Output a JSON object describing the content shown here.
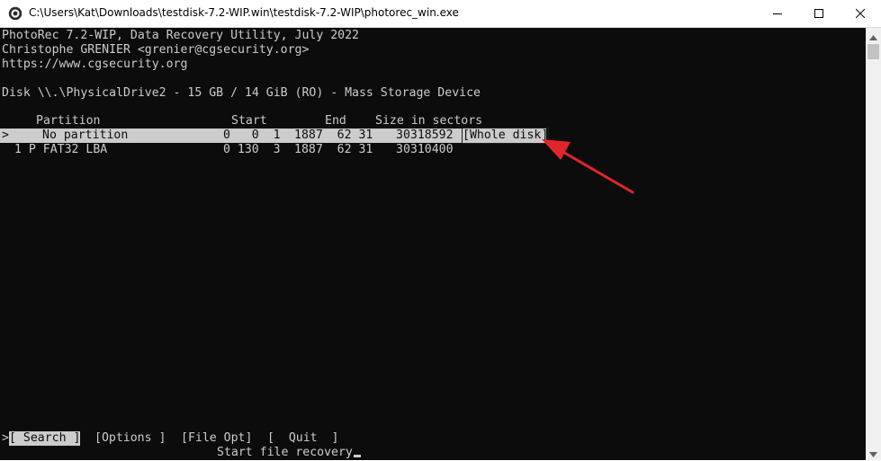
{
  "window": {
    "title": "C:\\Users\\Kat\\Downloads\\testdisk-7.2-WIP.win\\testdisk-7.2-WIP\\photorec_win.exe"
  },
  "header": {
    "line1": "PhotoRec 7.2-WIP, Data Recovery Utility, July 2022",
    "line2": "Christophe GRENIER <grenier@cgsecurity.org>",
    "line3": "https://www.cgsecurity.org"
  },
  "disk": {
    "line": "Disk \\\\.\\PhysicalDrive2 - 15 GB / 14 GiB (RO) - Mass Storage Device"
  },
  "table": {
    "columns": {
      "partition": "Partition",
      "start": "Start",
      "end": "End",
      "size": "Size in sectors"
    },
    "rows": [
      {
        "marker": ">",
        "partition": "No partition",
        "start": "0   0  1",
        "end": "1887  62 31",
        "size": "30318592",
        "tag": "[Whole disk]",
        "selected": true
      },
      {
        "marker": "",
        "partition": "1 P FAT32 LBA",
        "start": "0 130  3",
        "end": "1887  62 31",
        "size": "30310400",
        "tag": "",
        "selected": false
      }
    ]
  },
  "menu": {
    "selector": ">",
    "items": [
      {
        "label": "[ Search ]",
        "selected": true
      },
      {
        "label": "[Options ]",
        "selected": false
      },
      {
        "label": "[File Opt]",
        "selected": false
      },
      {
        "label": "[  Quit  ]",
        "selected": false
      }
    ],
    "hint": "Start file recovery"
  },
  "colors": {
    "console_bg": "#0c0c0c",
    "console_fg": "#cccccc",
    "highlight_bg": "#cccccc",
    "annotation_arrow": "#e0262c"
  }
}
